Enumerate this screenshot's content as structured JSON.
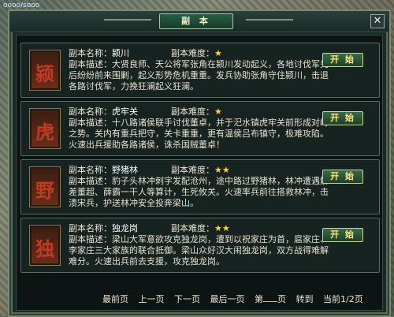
{
  "window": {
    "title": "副  本",
    "close_label": "✕"
  },
  "labels": {
    "name": "副本名称：",
    "difficulty": "副本难度：",
    "desc": "副本描述：",
    "start": "开 始"
  },
  "dungeons": [
    {
      "name": "颍川",
      "difficulty": "★",
      "glyph": "颍",
      "desc_line1": "大贤良师、天公将军张角在颍川发动起义，各地讨伐军先",
      "desc_line2": "后纷纷前来围剿，起义形势危机重重。发兵协助张角守住颍川，击退",
      "desc_line3": "各路讨伐军，力挽狂澜起义狂澜。"
    },
    {
      "name": "虎牢关",
      "difficulty": "★",
      "glyph": "虎",
      "desc_line1": "十八路诸侯联手讨伐董卓，并于汜水镇虎牢关前形成对峙",
      "desc_line2": "之势。关内有重兵把守，关卡重重，更有温侯吕布镇守，极难攻陷。",
      "desc_line3": "火速出兵援助各路诸侯，诛杀国贼董卓！"
    },
    {
      "name": "野猪林",
      "difficulty": "★★",
      "glyph": "野",
      "desc_line1": "豹子头林冲刺字发配沧州，途中路过野猪林，林冲遭遇解",
      "desc_line2": "差董超、薛霸一干人等算计，生死攸关。火速率兵前往搭救林冲，击",
      "desc_line3": "溃宋兵，护送林冲安全投奔梁山。"
    },
    {
      "name": "独龙岗",
      "difficulty": "★★",
      "glyph": "独",
      "desc_line1": "梁山大军意欲攻克独龙岗，遭到以祝家庄为首，扈家庄、",
      "desc_line2": "李家庄三大家族的联合抵御。梁山众好汉大闹独龙岗，双方战得难解",
      "desc_line3": "难分。火速出兵前去支援，攻克独龙岗。"
    }
  ],
  "pager": {
    "first": "最前页",
    "prev": "上一页",
    "next": "下一页",
    "last": "最后一页",
    "page_prefix": "第",
    "page_suffix": "页",
    "goto": "转到",
    "current": "当前1/2页"
  }
}
